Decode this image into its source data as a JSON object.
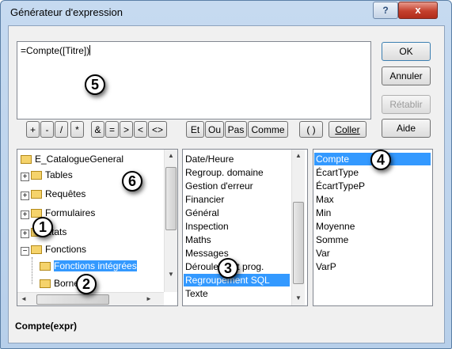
{
  "window": {
    "title": "Générateur d'expression",
    "help_label": "?",
    "close_label": "x"
  },
  "expression": {
    "value": "=Compte([Titre])"
  },
  "buttons": {
    "ok": "OK",
    "cancel": "Annuler",
    "restore": "Rétablir",
    "help": "Aide"
  },
  "operators": [
    "+",
    "-",
    "/",
    "*",
    "&",
    "=",
    ">",
    "<",
    "<>",
    "Et",
    "Ou",
    "Pas",
    "Comme",
    "( )",
    "Coller"
  ],
  "tree": {
    "items": [
      {
        "label": "E_CatalogueGeneral",
        "type": "folder"
      },
      {
        "label": "Tables",
        "type": "plus"
      },
      {
        "label": "Requêtes",
        "type": "plus"
      },
      {
        "label": "Formulaires",
        "type": "plus"
      },
      {
        "label": "États",
        "type": "plus"
      },
      {
        "label": "Fonctions",
        "type": "minus"
      },
      {
        "label": "Fonctions intégrées",
        "type": "folder",
        "selected": true
      },
      {
        "label": "Bornes",
        "type": "folder"
      }
    ]
  },
  "categories": {
    "items": [
      "Date/Heure",
      "Regroup. domaine",
      "Gestion d'erreur",
      "Financier",
      "Général",
      "Inspection",
      "Maths",
      "Messages",
      "Déroulement prog.",
      "Regroupement SQL",
      "Texte"
    ],
    "selected": "Regroupement SQL"
  },
  "functions": {
    "items": [
      "Compte",
      "ÉcartType",
      "ÉcartTypeP",
      "Max",
      "Min",
      "Moyenne",
      "Somme",
      "Var",
      "VarP"
    ],
    "selected": "Compte"
  },
  "status": "Compte(expr)",
  "markers": [
    "1",
    "2",
    "3",
    "4",
    "5",
    "6"
  ],
  "scroll_arrows": {
    "up": "▲",
    "down": "▼",
    "left": "◄",
    "right": "►"
  }
}
